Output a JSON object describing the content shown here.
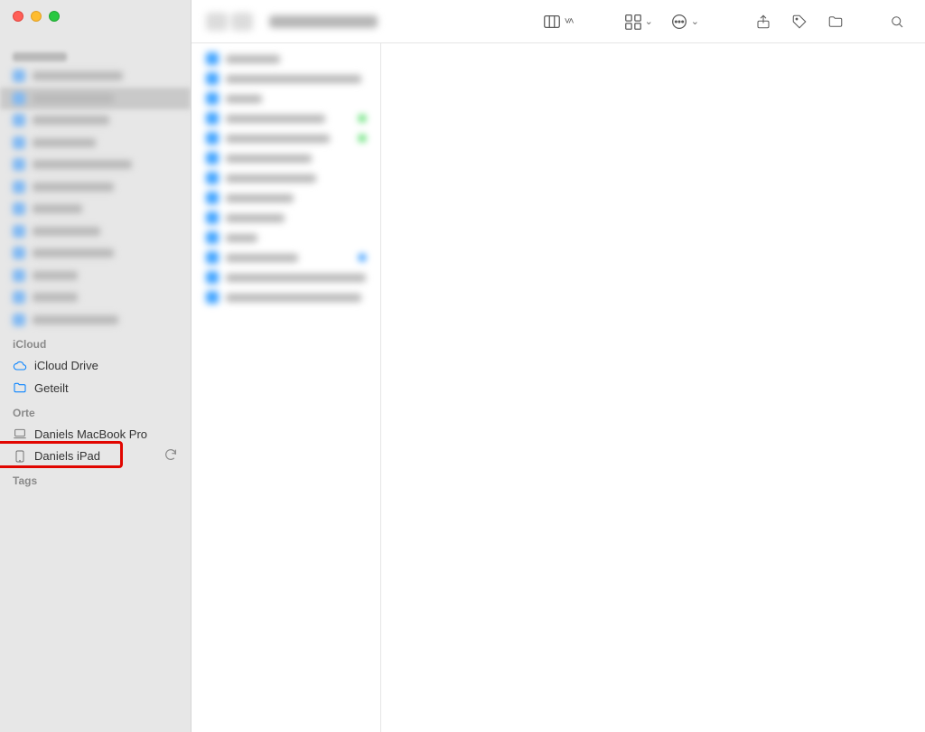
{
  "window": {
    "traffic": {
      "close": "close",
      "minimize": "minimize",
      "zoom": "zoom"
    }
  },
  "sidebar": {
    "favorites": {
      "label_blurred": true,
      "items": [
        {
          "blurred": true,
          "selected": false
        },
        {
          "blurred": true,
          "selected": true
        },
        {
          "blurred": true,
          "selected": false
        },
        {
          "blurred": true,
          "selected": false
        },
        {
          "blurred": true,
          "selected": false
        },
        {
          "blurred": true,
          "selected": false
        },
        {
          "blurred": true,
          "selected": false
        },
        {
          "blurred": true,
          "selected": false
        },
        {
          "blurred": true,
          "selected": false
        },
        {
          "blurred": true,
          "selected": false
        },
        {
          "blurred": true,
          "selected": false
        },
        {
          "blurred": true,
          "selected": false
        }
      ]
    },
    "icloud": {
      "label": "iCloud",
      "items": [
        {
          "icon": "cloud",
          "label": "iCloud Drive"
        },
        {
          "icon": "folder-shared",
          "label": "Geteilt"
        }
      ]
    },
    "locations": {
      "label": "Orte",
      "items": [
        {
          "icon": "laptop",
          "label": "Daniels MacBook Pro",
          "sync": false
        },
        {
          "icon": "tablet",
          "label": "Daniels iPad",
          "sync": true,
          "highlight": true
        }
      ]
    },
    "tags": {
      "label": "Tags"
    }
  },
  "toolbar": {
    "nav_blurred": true,
    "title_blurred": true,
    "view_columns": "columns view",
    "view_group": "group by",
    "more": "more options",
    "share": "share",
    "tag": "tag",
    "revert": "actions",
    "search": "search"
  },
  "list": {
    "rows": [
      {
        "w": 60,
        "tag": null
      },
      {
        "w": 150,
        "tag": null
      },
      {
        "w": 40,
        "tag": null
      },
      {
        "w": 110,
        "tag": "green"
      },
      {
        "w": 115,
        "tag": "green"
      },
      {
        "w": 95,
        "tag": null
      },
      {
        "w": 100,
        "tag": null
      },
      {
        "w": 75,
        "tag": null
      },
      {
        "w": 65,
        "tag": null
      },
      {
        "w": 35,
        "tag": null
      },
      {
        "w": 80,
        "tag": "blue"
      },
      {
        "w": 155,
        "tag": null
      },
      {
        "w": 150,
        "tag": null
      }
    ]
  }
}
